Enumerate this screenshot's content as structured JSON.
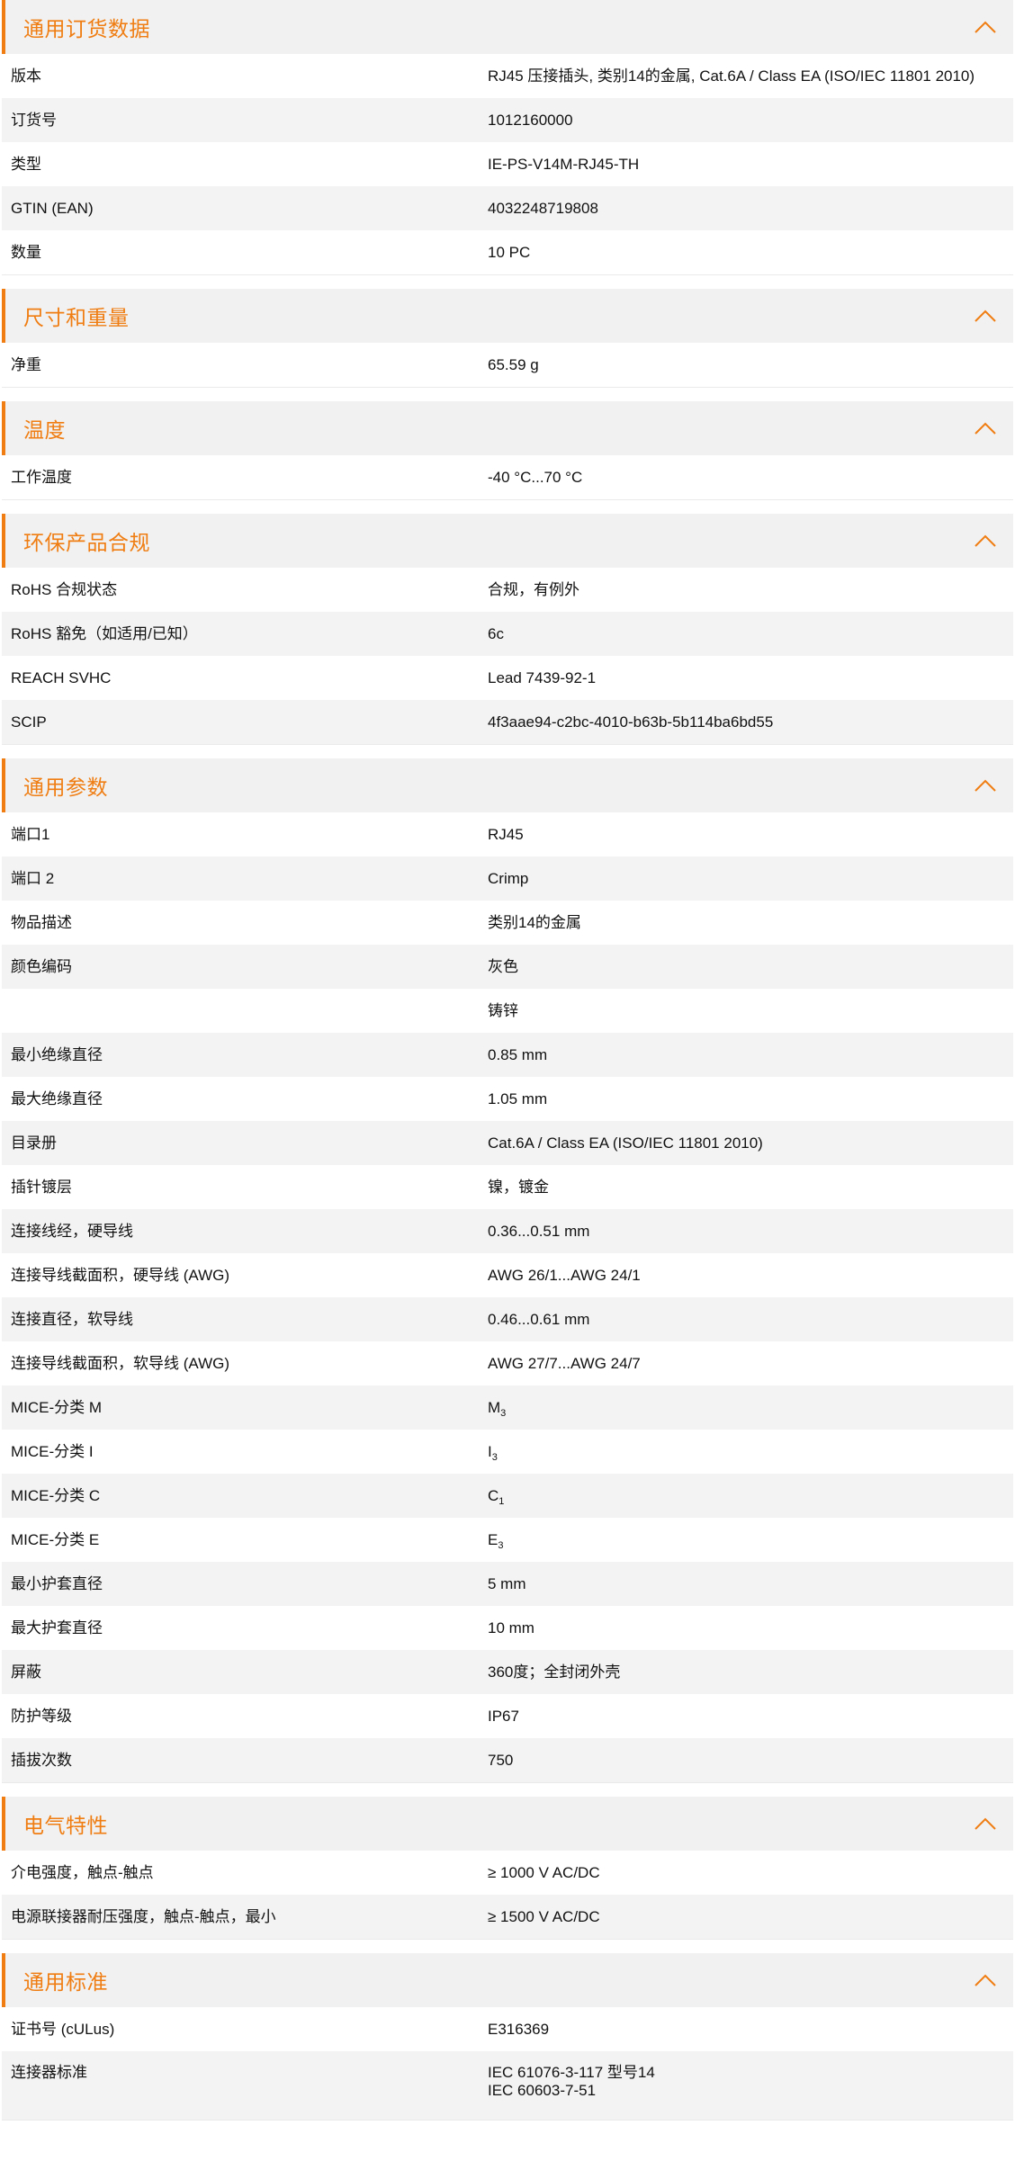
{
  "theme": {
    "accent": "#ef7d12",
    "header_bg": "#f1f1f1",
    "row_alt_bg": "#f3f3f3"
  },
  "sections": [
    {
      "title": "通用订货数据",
      "icon": "chevron-up-icon",
      "rows": [
        {
          "label": "版本",
          "value": "RJ45 压接插头, 类别14的金属, Cat.6A / Class EA (ISO/IEC 11801 2010)"
        },
        {
          "label": "订货号",
          "value": "1012160000"
        },
        {
          "label": "类型",
          "value": "IE-PS-V14M-RJ45-TH"
        },
        {
          "label": "GTIN (EAN)",
          "value": "4032248719808"
        },
        {
          "label": "数量",
          "value": "10  PC"
        }
      ]
    },
    {
      "title": "尺寸和重量",
      "icon": "chevron-up-icon",
      "rows": [
        {
          "label": "净重",
          "value": "65.59  g"
        }
      ]
    },
    {
      "title": "温度",
      "icon": "chevron-up-icon",
      "rows": [
        {
          "label": "工作温度",
          "value": "-40 °C...70 °C"
        }
      ]
    },
    {
      "title": "环保产品合规",
      "icon": "chevron-up-icon",
      "rows": [
        {
          "label": "RoHS 合规状态",
          "value": "合规，有例外"
        },
        {
          "label": "RoHS 豁免（如适用/已知）",
          "value": "6c"
        },
        {
          "label": "REACH SVHC",
          "value": "Lead 7439-92-1"
        },
        {
          "label": "SCIP",
          "value": "4f3aae94-c2bc-4010-b63b-5b114ba6bd55"
        }
      ]
    },
    {
      "title": "通用参数",
      "icon": "chevron-up-icon",
      "rows": [
        {
          "label": "端口1",
          "value": "RJ45"
        },
        {
          "label": "端口 2",
          "value": "Crimp"
        },
        {
          "label": "物品描述",
          "value": "类别14的金属"
        },
        {
          "label": "颜色编码",
          "value": "灰色"
        },
        {
          "label": "",
          "value": "铸锌"
        },
        {
          "label": "最小绝缘直径",
          "value": "0.85  mm"
        },
        {
          "label": "最大绝缘直径",
          "value": "1.05  mm"
        },
        {
          "label": "目录册",
          "value": "Cat.6A / Class EA (ISO/IEC 11801 2010)"
        },
        {
          "label": "插针镀层",
          "value": "镍，镀金"
        },
        {
          "label": "连接线经，硬导线",
          "value": "0.36...0.51 mm"
        },
        {
          "label": "连接导线截面积，硬导线 (AWG)",
          "value": "AWG 26/1...AWG 24/1"
        },
        {
          "label": "连接直径，软导线",
          "value": "0.46...0.61 mm"
        },
        {
          "label": "连接导线截面积，软导线 (AWG)",
          "value": "AWG 27/7...AWG 24/7"
        },
        {
          "label": "MICE-分类 M",
          "value": "M",
          "sub": "3"
        },
        {
          "label": "MICE-分类 I",
          "value": "I",
          "sub": "3"
        },
        {
          "label": "MICE-分类 C",
          "value": "C",
          "sub": "1"
        },
        {
          "label": "MICE-分类 E",
          "value": "E",
          "sub": "3"
        },
        {
          "label": "最小护套直径",
          "value": "5  mm"
        },
        {
          "label": "最大护套直径",
          "value": "10  mm"
        },
        {
          "label": "屏蔽",
          "value": "360度；全封闭外壳"
        },
        {
          "label": "防护等级",
          "value": "IP67"
        },
        {
          "label": "插拔次数",
          "value": "750"
        }
      ]
    },
    {
      "title": "电气特性",
      "icon": "chevron-up-icon",
      "rows": [
        {
          "label": "介电强度，触点-触点",
          "value": "≥ 1000 V AC/DC"
        },
        {
          "label": "电源联接器耐压强度，触点-触点，最小",
          "value": "≥ 1500 V AC/DC"
        }
      ]
    },
    {
      "title": "通用标准",
      "icon": "chevron-up-icon",
      "rows": [
        {
          "label": "证书号 (cULus)",
          "value": "E316369"
        },
        {
          "label": "连接器标准",
          "value": "IEC 61076-3-117 型号14",
          "value2": "IEC 60603-7-51"
        }
      ]
    }
  ]
}
